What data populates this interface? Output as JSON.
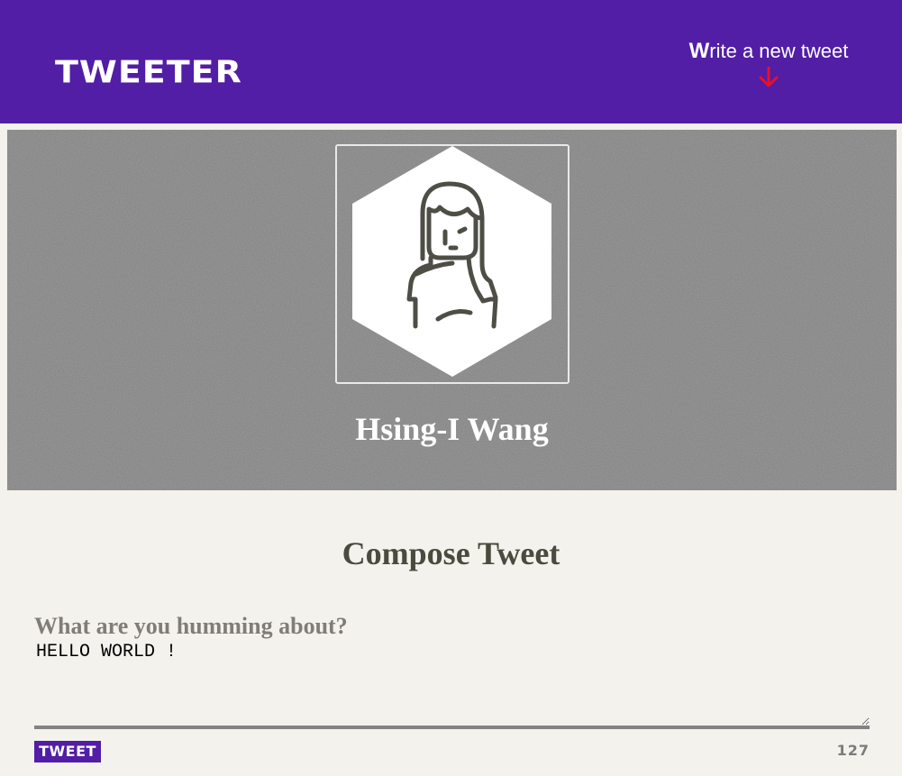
{
  "nav": {
    "brand": "TWEETER",
    "write_first": "W",
    "write_rest": "rite a new tweet",
    "arrow_icon": "arrow-down-icon",
    "arrow_color": "#e8102a",
    "background": "#521ea5"
  },
  "profile": {
    "avatar_icon": "user-avatar-icon",
    "name": "Hsing-I Wang"
  },
  "compose": {
    "title": "Compose Tweet",
    "label": "What are you humming about?",
    "value": "HELLO WORLD !",
    "button_label": "TWEET",
    "counter": "127"
  }
}
